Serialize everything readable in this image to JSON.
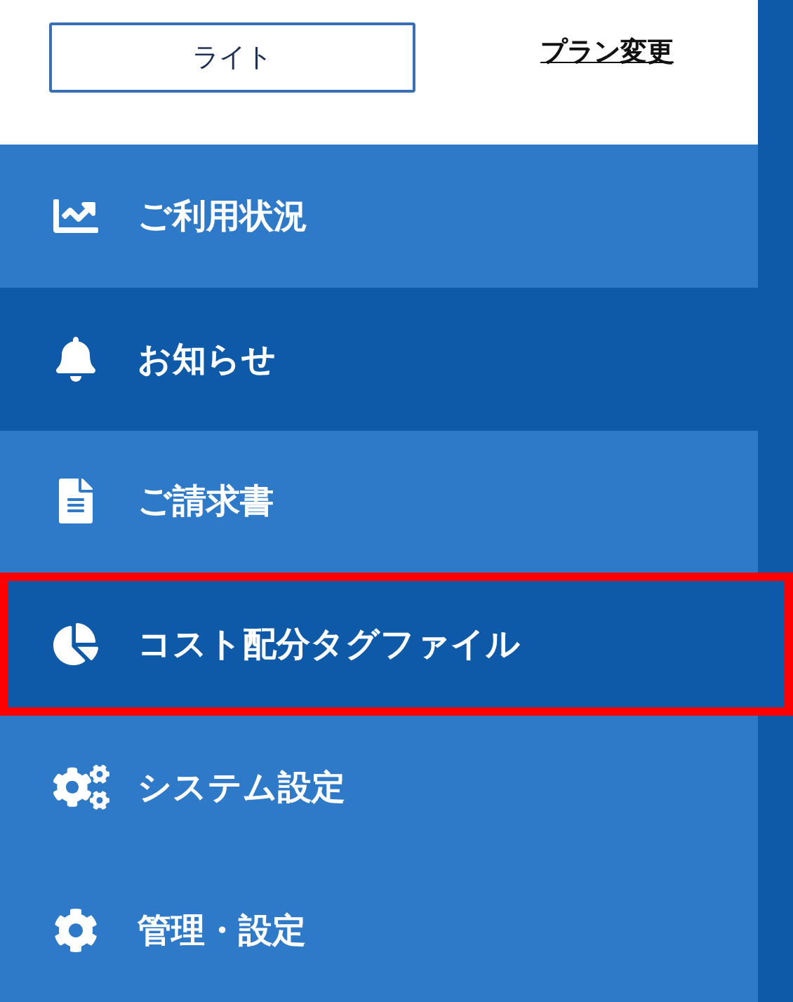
{
  "plan": {
    "name": "ライト",
    "change_link": "プラン変更"
  },
  "menu": [
    {
      "label": "ご利用状況",
      "active": false,
      "highlighted": false
    },
    {
      "label": "お知らせ",
      "active": true,
      "highlighted": false
    },
    {
      "label": "ご請求書",
      "active": false,
      "highlighted": false
    },
    {
      "label": "コスト配分タグファイル",
      "active": true,
      "highlighted": true
    },
    {
      "label": "システム設定",
      "active": false,
      "highlighted": false
    },
    {
      "label": "管理・設定",
      "active": false,
      "highlighted": false
    }
  ]
}
